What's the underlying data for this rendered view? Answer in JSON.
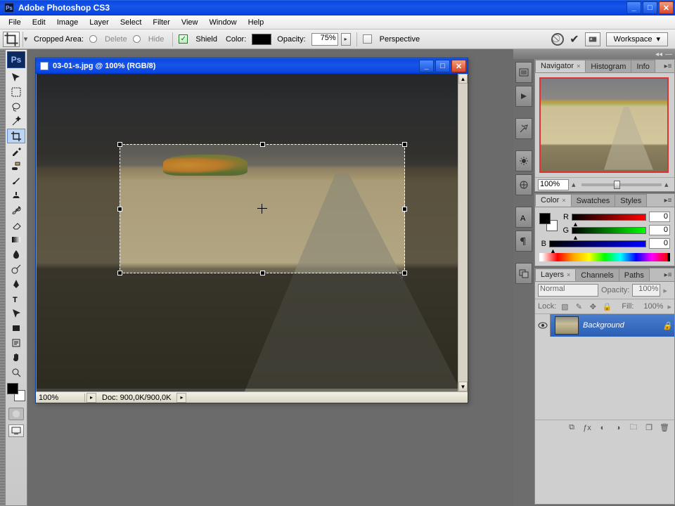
{
  "app": {
    "title": "Adobe Photoshop CS3"
  },
  "menu": [
    "File",
    "Edit",
    "Image",
    "Layer",
    "Select",
    "Filter",
    "View",
    "Window",
    "Help"
  ],
  "options": {
    "section_label": "Cropped Area:",
    "radio_delete": "Delete",
    "radio_hide": "Hide",
    "shield_label": "Shield",
    "color_label": "Color:",
    "opacity_label": "Opacity:",
    "opacity_value": "75%",
    "perspective_label": "Perspective",
    "workspace_label": "Workspace"
  },
  "document": {
    "title": "03-01-s.jpg @ 100% (RGB/8)",
    "status_zoom": "100%",
    "status_docinfo": "Doc: 900,0K/900,0K"
  },
  "panels": {
    "navigator": {
      "tabs": [
        "Navigator",
        "Histogram",
        "Info"
      ],
      "zoom_value": "100%"
    },
    "color": {
      "tabs": [
        "Color",
        "Swatches",
        "Styles"
      ],
      "r_label": "R",
      "g_label": "G",
      "b_label": "B",
      "r_value": "0",
      "g_value": "0",
      "b_value": "0"
    },
    "layers": {
      "tabs": [
        "Layers",
        "Channels",
        "Paths"
      ],
      "blend_mode": "Normal",
      "opacity_label": "Opacity:",
      "opacity_value": "100%",
      "lock_label": "Lock:",
      "fill_label": "Fill:",
      "fill_value": "100%",
      "bg_layer_name": "Background"
    }
  }
}
